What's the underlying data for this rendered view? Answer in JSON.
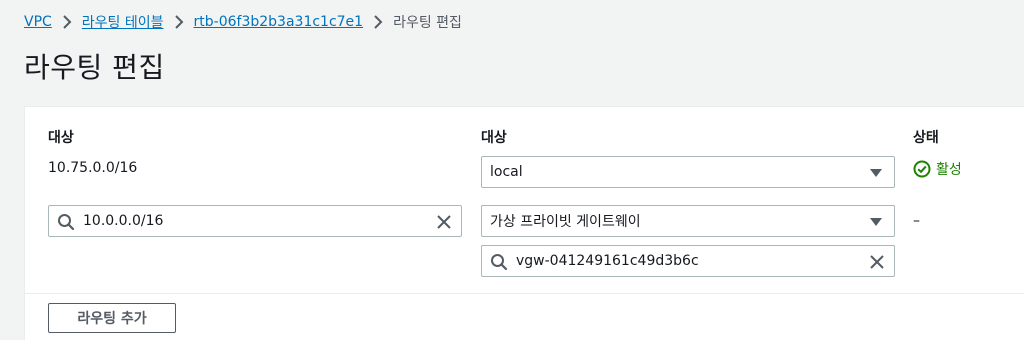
{
  "breadcrumb": {
    "vpc": "VPC",
    "route_tables": "라우팅 테이블",
    "route_table_id": "rtb-06f3b2b3a31c1c7e1",
    "current": "라우팅 편집"
  },
  "page_title": "라우팅 편집",
  "columns": {
    "destination": "대상",
    "target": "대상",
    "status": "상태"
  },
  "routes": [
    {
      "destination": "10.75.0.0/16",
      "target_type": "local",
      "status": "활성"
    },
    {
      "destination_value": "10.0.0.0/16",
      "target_type": "가상 프라이빗 게이트웨이",
      "target_value": "vgw-041249161c49d3b6c",
      "status": "–"
    }
  ],
  "add_route_label": "라우팅 추가",
  "colors": {
    "link": "#0073bb",
    "success": "#1d8102",
    "background": "#f2f3f3",
    "border": "#aab7b8"
  }
}
